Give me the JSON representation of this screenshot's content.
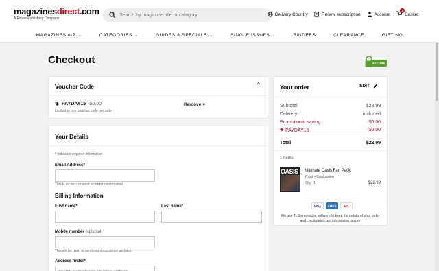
{
  "header": {
    "logo_main_a": "magazines",
    "logo_main_b": "direct",
    "logo_main_c": ".com",
    "logo_sub": "A Future Publishing Company",
    "search_placeholder": "Search by magazine title or category",
    "links": {
      "country": "Delivery Country",
      "renew": "Renew subscription",
      "account": "Account",
      "basket": "Basket",
      "basket_count": "1"
    }
  },
  "nav": {
    "items": [
      {
        "label": "MAGAZINES A-Z",
        "dropdown": true
      },
      {
        "label": "CATEGORIES",
        "dropdown": true
      },
      {
        "label": "GUIDES & SPECIALS",
        "dropdown": true
      },
      {
        "label": "SINGLE ISSUES",
        "dropdown": true
      },
      {
        "label": "BINDERS",
        "dropdown": false
      },
      {
        "label": "CLEARANCE",
        "dropdown": false
      },
      {
        "label": "GIFTING",
        "dropdown": false
      }
    ]
  },
  "page": {
    "title": "Checkout",
    "secure_badge": "SECURE"
  },
  "voucher": {
    "title": "Voucher Code",
    "toggle": "^",
    "code": "PAYDAY15",
    "amount": "-$0.00",
    "hint": "Limited to one voucher code per order",
    "remove_label": "Remove",
    "remove_icon": "×"
  },
  "details": {
    "title": "Your Details",
    "required_note": "* Indicates required information",
    "email_label": "Email Address*",
    "email_note": "This is so we can send an order confirmation",
    "billing_title": "Billing Information",
    "first_name_label": "First name*",
    "last_name_label": "Last name*",
    "mobile_label": "Mobile number",
    "mobile_optional": "(optional)",
    "mobile_note": "This will be used to send you subscription updates",
    "address_label": "Address finder*",
    "address_placeholder": "Search by postcode, street or address"
  },
  "order": {
    "title": "Your order",
    "edit_label": "EDIT",
    "subtotal_label": "Subtotal",
    "subtotal_value": "$22.99",
    "delivery_label": "Delivery",
    "delivery_value": "included",
    "promo_label": "Promotional saving",
    "promo_value": "-$0.00",
    "voucher_label": "PAYDAY15",
    "voucher_value": "-$0.00",
    "total_label": "Total",
    "total_value": "$22.99",
    "items_count": "1 Items",
    "product": {
      "cover_title": "OASIS",
      "name": "Ultimate Oasis Fan Pack",
      "type": "Print • Bookazine",
      "qty": "Qty: 1",
      "price": "$22.99"
    },
    "cards": [
      "VISA",
      "AMEX",
      "MC"
    ],
    "tls_note": "We use TLS encryption software to keep the details of your order and credit/debit card information secure"
  },
  "colors": {
    "brand_red": "#c1121f",
    "promo_red": "#b3122b",
    "secure_green": "#5a9e2f"
  }
}
